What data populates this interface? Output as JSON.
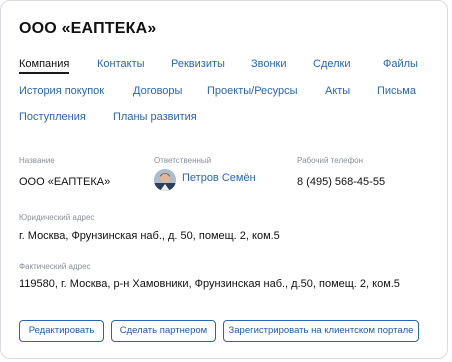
{
  "company": {
    "title": "ООО «ЕАПТЕКА»"
  },
  "tabs": [
    "Компания",
    "Контакты",
    "Реквизиты",
    "Звонки",
    "Сделки",
    "Файлы",
    "История покупок",
    "Договоры",
    "Проекты/Ресурсы",
    "Акты",
    "Письма",
    "Поступления",
    "Планы развития"
  ],
  "fields": {
    "name_label": "Название",
    "name_value": "ООО «ЕАПТЕКА»",
    "responsible_label": "Ответственный",
    "responsible_value": "Петров Семён",
    "phone_label": "Рабочий телефон",
    "phone_value": "8 (495) 568-45-55",
    "legal_address_label": "Юридический адрес",
    "legal_address_value": "г. Москва, Фрунзинская наб., д. 50, помещ. 2, ком.5",
    "actual_address_label": "Фактический адрес",
    "actual_address_value": "119580, г. Москва, р-н Хамовники,  Фрунзинская наб., д.50, помещ. 2, ком.5"
  },
  "buttons": {
    "edit": "Редактировать",
    "partner": "Сделать партнером",
    "register": "Зарегистрировать на клиентском портале"
  },
  "colors": {
    "accent": "#2a66b4",
    "border": "#d9dde3",
    "muted": "#8a9099"
  }
}
